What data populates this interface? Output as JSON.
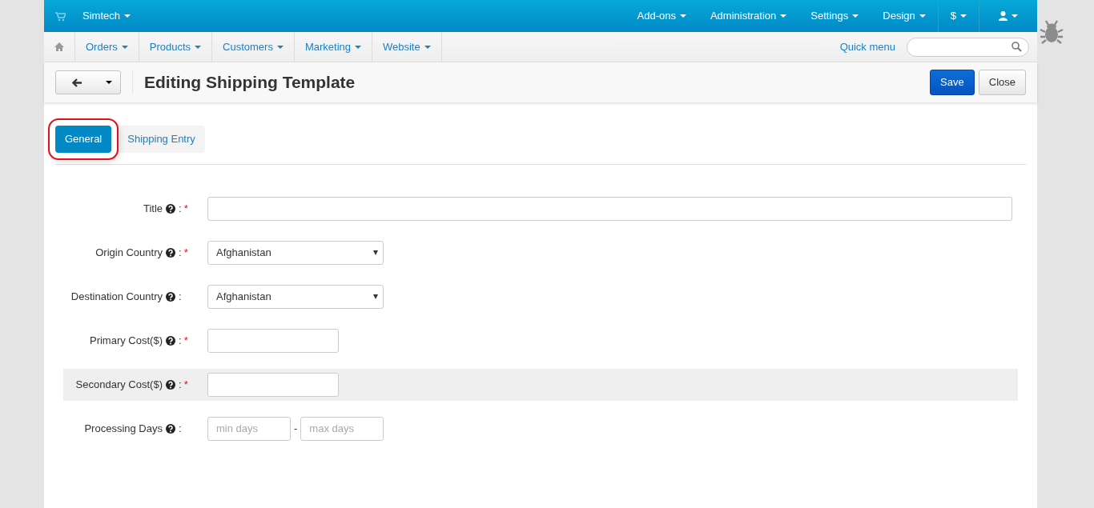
{
  "top_nav": {
    "brand": "Simtech",
    "menus": [
      "Add-ons",
      "Administration",
      "Settings",
      "Design"
    ],
    "currency": "$"
  },
  "main_nav": {
    "items": [
      "Orders",
      "Products",
      "Customers",
      "Marketing",
      "Website"
    ],
    "quick_menu": "Quick menu"
  },
  "toolbar": {
    "title": "Editing Shipping Template",
    "buttons": [
      {
        "label": "Save",
        "kind": "primary"
      },
      {
        "label": "Close",
        "kind": "default"
      }
    ]
  },
  "tabs": [
    {
      "label": "General",
      "selected": true,
      "annotated": true
    },
    {
      "label": "Shipping Entry",
      "selected": false,
      "annotated": false
    }
  ],
  "fields": [
    {
      "label": "Title",
      "colon": ":",
      "required_mark": "*",
      "kind": "wide_text",
      "highlighted": false
    },
    {
      "label": "Origin Country",
      "colon": ":",
      "required_mark": "*",
      "kind": "select",
      "highlighted": false,
      "value": "Afghanistan"
    },
    {
      "label": "Destination Country",
      "colon": ":",
      "kind": "select",
      "highlighted": false,
      "value": "Afghanistan"
    },
    {
      "label": "Primary Cost($)",
      "colon": ":",
      "required_mark": "*",
      "kind": "short_text",
      "highlighted": false
    },
    {
      "label": "Secondary Cost($)",
      "colon": ":",
      "required_mark": "*",
      "kind": "short_text",
      "highlighted": true
    },
    {
      "label": "Processing Days",
      "colon": ":",
      "kind": "range",
      "highlighted": false,
      "placeholder": "min days",
      "placeholder_2": "max days",
      "separator": "-"
    }
  ]
}
